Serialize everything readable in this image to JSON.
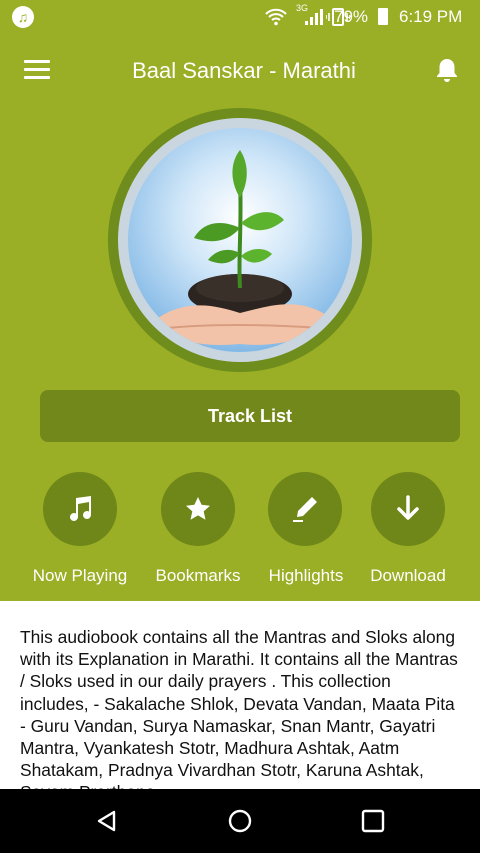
{
  "status_bar": {
    "network": "3G",
    "battery_percent": "79%",
    "time": "6:19 PM"
  },
  "app_bar": {
    "title": "Baal Sanskar - Marathi"
  },
  "hero_image": {
    "icon": "plant-in-hands-image"
  },
  "track_list_button": {
    "label": "Track List"
  },
  "actions": [
    {
      "label": "Now Playing",
      "icon": "music-note-icon"
    },
    {
      "label": "Bookmarks",
      "icon": "star-icon"
    },
    {
      "label": "Highlights",
      "icon": "pen-icon"
    },
    {
      "label": "Download",
      "icon": "arrow-down-icon"
    }
  ],
  "description": {
    "text": "This audiobook contains all the Mantras and Sloks along with its Explanation in Marathi. It contains all the Mantras / Sloks used in our daily prayers . This collection includes, - Sakalache Shlok, Devata Vandan, Maata Pita - Guru Vandan, Surya Namaskar, Snan Mantr, Gayatri Mantra, Vyankatesh Stotr, Madhura Ashtak, Aatm Shatakam, Pradnya Vivardhan Stotr, Karuna Ashtak, Sayam Prarthana"
  },
  "colors": {
    "primary": "#9aae26",
    "button_dark": "#73881b",
    "circle_button": "#6f8618"
  }
}
